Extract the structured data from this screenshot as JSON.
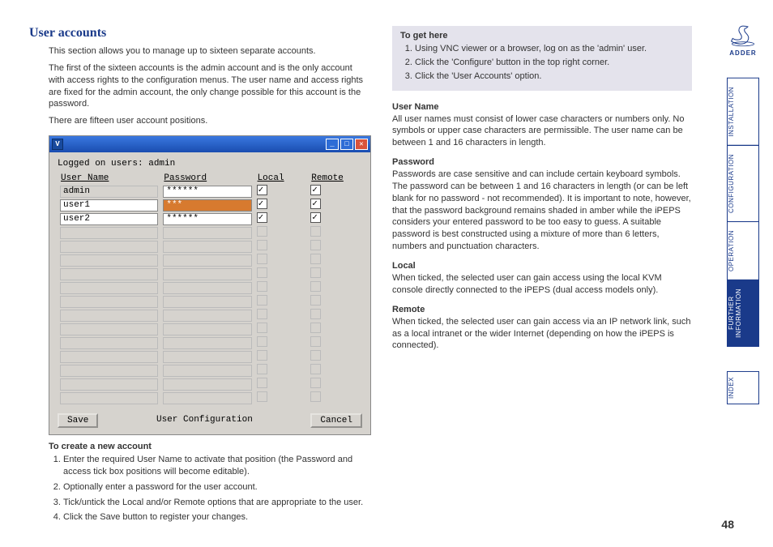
{
  "title": "User accounts",
  "intro": {
    "p1": "This section allows you to manage up to sixteen separate accounts.",
    "p2": "The first of the sixteen accounts is the admin account and is the only account with access rights to the configuration menus. The user name and access rights are fixed for the admin account, the only change possible for this account is the password.",
    "p3": "There are fifteen user account positions."
  },
  "screenshot": {
    "logged_label": "Logged on users:",
    "logged_value": "admin",
    "headers": {
      "user": "User Name",
      "password": "Password",
      "local": "Local",
      "remote": "Remote"
    },
    "rows": [
      {
        "user": "admin",
        "password": "******",
        "local": true,
        "remote": true,
        "pw_amber": false,
        "disabled": false,
        "user_disabled": true
      },
      {
        "user": "user1",
        "password": "***",
        "local": true,
        "remote": true,
        "pw_amber": true,
        "disabled": false,
        "user_disabled": false
      },
      {
        "user": "user2",
        "password": "******",
        "local": true,
        "remote": true,
        "pw_amber": false,
        "disabled": false,
        "user_disabled": false
      },
      {
        "user": "",
        "password": "",
        "local": false,
        "remote": false,
        "disabled": true
      },
      {
        "user": "",
        "password": "",
        "local": false,
        "remote": false,
        "disabled": true
      },
      {
        "user": "",
        "password": "",
        "local": false,
        "remote": false,
        "disabled": true
      },
      {
        "user": "",
        "password": "",
        "local": false,
        "remote": false,
        "disabled": true
      },
      {
        "user": "",
        "password": "",
        "local": false,
        "remote": false,
        "disabled": true
      },
      {
        "user": "",
        "password": "",
        "local": false,
        "remote": false,
        "disabled": true
      },
      {
        "user": "",
        "password": "",
        "local": false,
        "remote": false,
        "disabled": true
      },
      {
        "user": "",
        "password": "",
        "local": false,
        "remote": false,
        "disabled": true
      },
      {
        "user": "",
        "password": "",
        "local": false,
        "remote": false,
        "disabled": true
      },
      {
        "user": "",
        "password": "",
        "local": false,
        "remote": false,
        "disabled": true
      },
      {
        "user": "",
        "password": "",
        "local": false,
        "remote": false,
        "disabled": true
      },
      {
        "user": "",
        "password": "",
        "local": false,
        "remote": false,
        "disabled": true
      },
      {
        "user": "",
        "password": "",
        "local": false,
        "remote": false,
        "disabled": true
      }
    ],
    "footer": {
      "save": "Save",
      "title": "User Configuration",
      "cancel": "Cancel"
    }
  },
  "create": {
    "heading": "To create a new account",
    "steps": [
      "Enter the required User Name to activate that position (the Password and access tick box positions will become editable).",
      "Optionally enter a password for the user account.",
      "Tick/untick the Local and/or Remote options that are appropriate to the user.",
      "Click the Save button to register your changes."
    ]
  },
  "togethere": {
    "heading": "To get here",
    "steps": [
      "Using VNC viewer or a browser, log on as the 'admin' user.",
      "Click the 'Configure' button in the top right corner.",
      "Click the 'User Accounts' option."
    ]
  },
  "fields": {
    "username": {
      "title": "User Name",
      "body": "All user names must consist of lower case characters or numbers only. No symbols or upper case characters are permissible. The user name can be between 1 and 16 characters in length."
    },
    "password": {
      "title": "Password",
      "body": "Passwords are case sensitive and can include certain keyboard symbols. The password can be between 1 and 16 characters in length (or can be left blank for no password - not recommended). It is important to note, however, that the password background remains shaded in amber while the iPEPS considers your entered password to be too easy to guess. A suitable password is best constructed using a mixture of more than 6 letters, numbers and punctuation characters."
    },
    "local": {
      "title": "Local",
      "body": "When ticked, the selected user can gain access using the local KVM console directly connected to the iPEPS (dual access models only)."
    },
    "remote": {
      "title": "Remote",
      "body": "When ticked, the selected user can gain access via an IP network link, such as a local intranet or the wider Internet (depending on how the iPEPS is connected)."
    }
  },
  "sidebar": {
    "brand": "ADDER",
    "tabs": {
      "installation": "INSTALLATION",
      "configuration": "CONFIGURATION",
      "operation": "OPERATION",
      "further": "FURTHER\nINFORMATION",
      "index": "INDEX"
    }
  },
  "page_number": "48"
}
